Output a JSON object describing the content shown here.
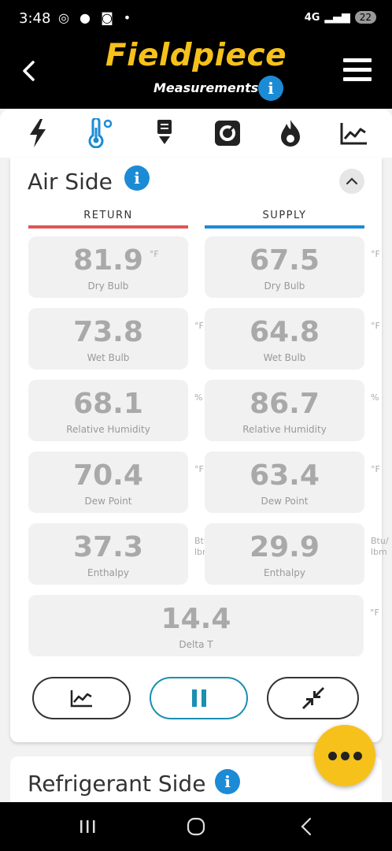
{
  "status_bar": {
    "time": "3:48",
    "notification_icons": "◎ ● ◙ •",
    "network": "4G",
    "signal": "▂▄▆",
    "battery": "22"
  },
  "header": {
    "logo_text": "Fieldpiece",
    "subtitle": "Measurements",
    "info_label": "i"
  },
  "tabs": [
    {
      "name": "electrical",
      "icon": "lightning-icon",
      "active": false
    },
    {
      "name": "temperature",
      "icon": "thermometer-icon",
      "active": true
    },
    {
      "name": "download",
      "icon": "download-icon",
      "active": false
    },
    {
      "name": "gauge",
      "icon": "gauge-icon",
      "active": false
    },
    {
      "name": "combustion",
      "icon": "flame-icon",
      "active": false
    },
    {
      "name": "trend",
      "icon": "chart-icon",
      "active": false
    }
  ],
  "air_side": {
    "title": "Air Side",
    "info_label": "i",
    "return_header": "RETURN",
    "supply_header": "SUPPLY",
    "return_color": "#e05555",
    "supply_color": "#1c8bd6",
    "return": [
      {
        "value": "81.9",
        "unit": "°F",
        "label": "Dry Bulb"
      },
      {
        "value": "73.8",
        "unit": "°F",
        "label": "Wet Bulb"
      },
      {
        "value": "68.1",
        "unit": "%",
        "label": "Relative Humidity"
      },
      {
        "value": "70.4",
        "unit": "°F",
        "label": "Dew Point"
      },
      {
        "value": "37.3",
        "unit": "Btu/\nlbm",
        "label": "Enthalpy"
      }
    ],
    "supply": [
      {
        "value": "67.5",
        "unit": "°F",
        "label": "Dry Bulb"
      },
      {
        "value": "64.8",
        "unit": "°F",
        "label": "Wet Bulb"
      },
      {
        "value": "86.7",
        "unit": "%",
        "label": "Relative Humidity"
      },
      {
        "value": "63.4",
        "unit": "°F",
        "label": "Dew Point"
      },
      {
        "value": "29.9",
        "unit": "Btu/\nlbm",
        "label": "Enthalpy"
      }
    ],
    "delta": {
      "value": "14.4",
      "unit": "°F",
      "label": "Delta T"
    }
  },
  "refrigerant_side": {
    "title": "Refrigerant Side",
    "info_label": "i"
  },
  "colors": {
    "brand_yellow": "#f7c11b",
    "info_blue": "#1c8bd6",
    "pause_teal": "#1a8fb0"
  }
}
